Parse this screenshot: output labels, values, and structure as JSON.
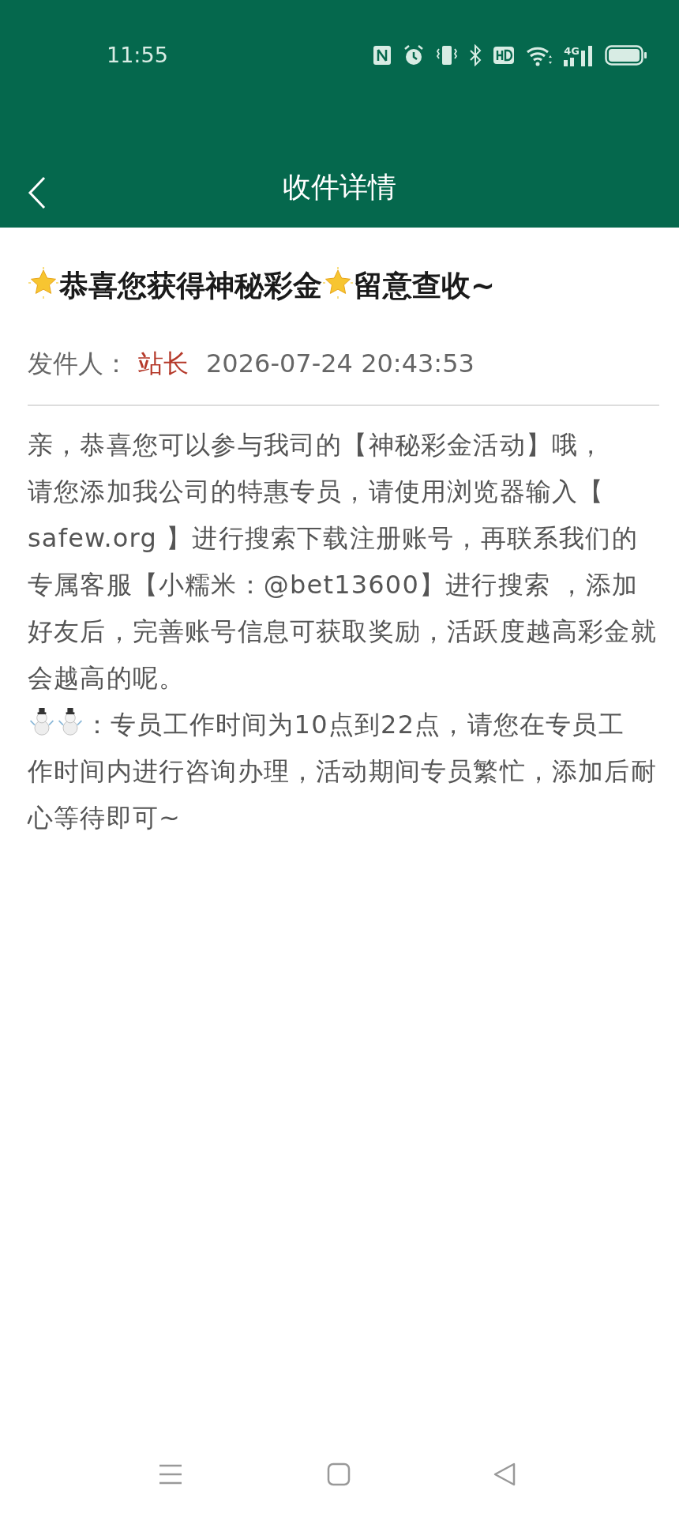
{
  "status_bar": {
    "time": "11:55",
    "network": "4G"
  },
  "header": {
    "title": "收件详情"
  },
  "message": {
    "title": [
      {
        "kind": "star"
      },
      {
        "kind": "text",
        "text": "恭喜您获得神秘彩金"
      },
      {
        "kind": "star"
      },
      {
        "kind": "text",
        "text": "留意查收~"
      }
    ],
    "sender_label": "发件人：",
    "sender": "站长",
    "date": "2026-07-24 20:43:53",
    "body": [
      [
        {
          "kind": "text",
          "text": "亲，恭喜您可以参与我司的【神秘彩金活动】哦，"
        }
      ],
      [
        {
          "kind": "text",
          "text": "请您添加我公司的特惠专员，请使用浏览器输入【 safew.org 】进行搜索下载注册账号，再联系我们的专属客服【小糯米：@bet13600】进行搜索 ，添加好友后，完善账号信息可获取奖励，活跃度越高彩金就会越高的呢。"
        }
      ],
      [
        {
          "kind": "snowman"
        },
        {
          "kind": "snowman"
        },
        {
          "kind": "text",
          "text": "：专员工作时间为10点到22点，请您在专员工"
        },
        {
          "kind": "line",
          "text": "作时间内进行咨询办理，活动期间专员繁忙，添加后耐心等待即可~"
        }
      ]
    ]
  }
}
